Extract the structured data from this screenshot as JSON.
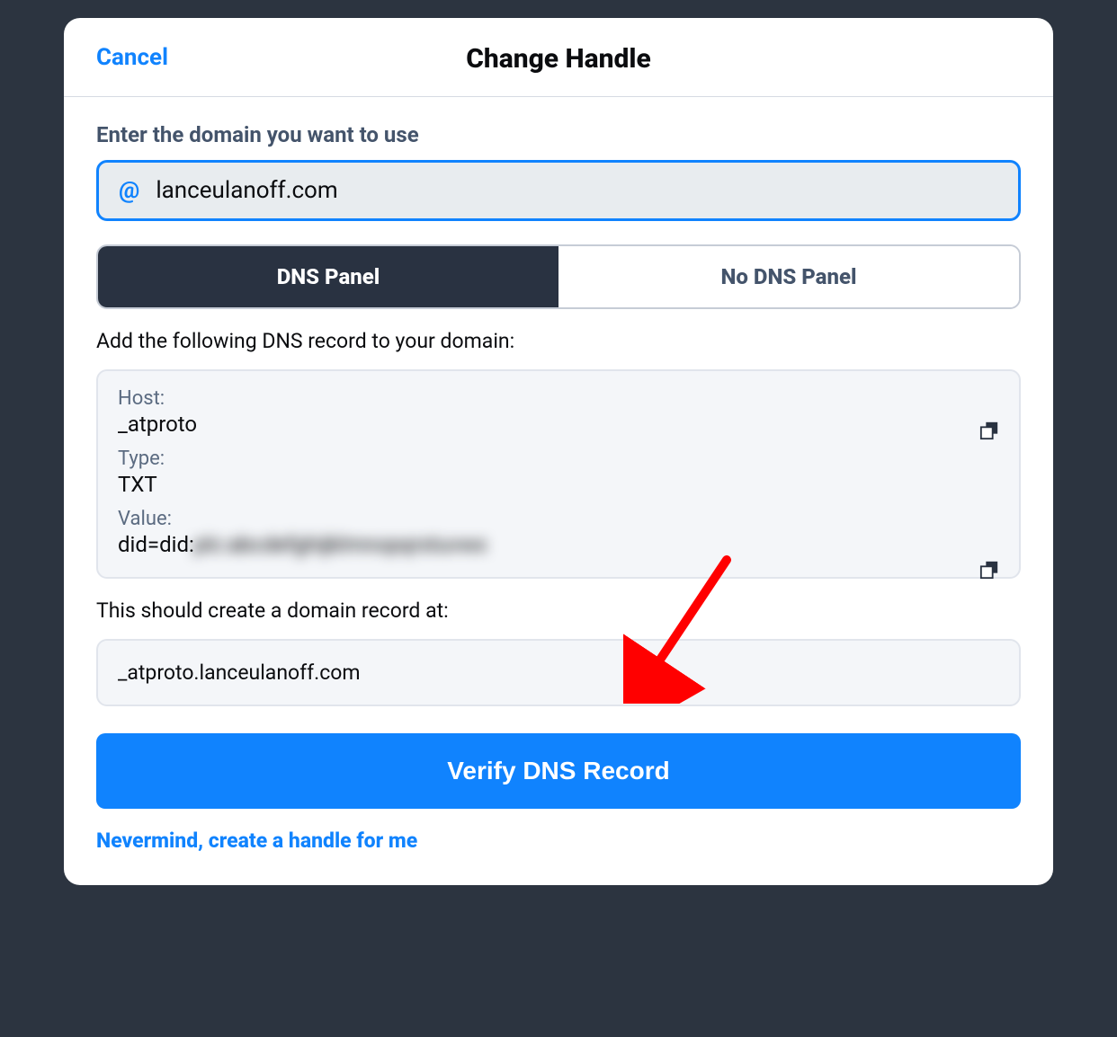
{
  "header": {
    "cancel_label": "Cancel",
    "title": "Change Handle"
  },
  "form": {
    "domain_prompt": "Enter the domain you want to use",
    "domain_value": "lanceulanoff.com",
    "at_symbol": "@"
  },
  "tabs": {
    "dns_panel": "DNS Panel",
    "no_dns_panel": "No DNS Panel"
  },
  "dns": {
    "instruction": "Add the following DNS record to your domain:",
    "host_label": "Host:",
    "host_value": "_atproto",
    "type_label": "Type:",
    "type_value": "TXT",
    "value_label": "Value:",
    "value_prefix": "did=did:",
    "value_hidden": "plc:abcdefghijklmnopqrstuvwx",
    "record_prompt": "This should create a domain record at:",
    "record_value": "_atproto.lanceulanoff.com"
  },
  "actions": {
    "verify_label": "Verify DNS Record",
    "nevermind_label": "Nevermind, create a handle for me"
  }
}
